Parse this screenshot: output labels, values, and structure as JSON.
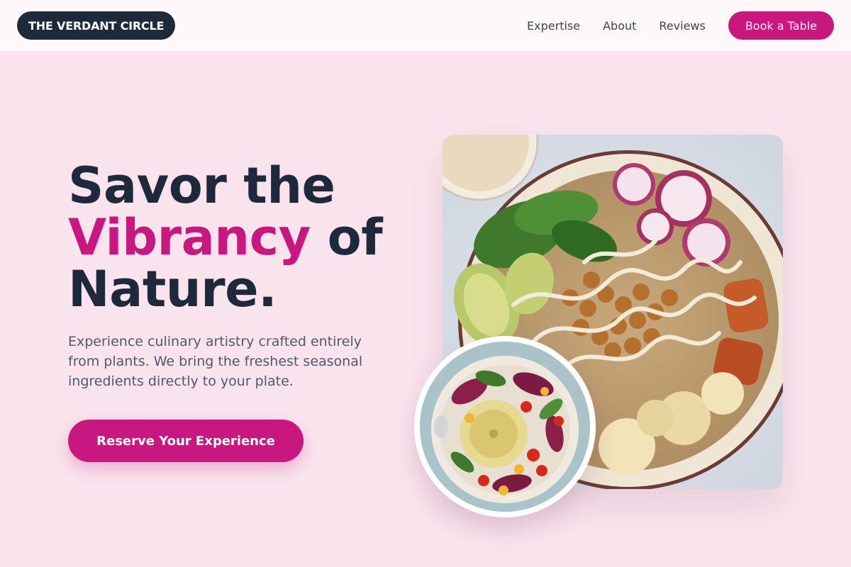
{
  "header": {
    "logo": "THE VERDANT CIRCLE",
    "nav": [
      {
        "label": "Expertise"
      },
      {
        "label": "About"
      },
      {
        "label": "Reviews"
      }
    ],
    "cta_label": "Book a Table"
  },
  "hero": {
    "title_line1": "Savor the",
    "title_accent": "Vibrancy",
    "title_line2_rest": " of",
    "title_line3": "Nature.",
    "subtitle": "Experience culinary artistry crafted entirely from plants. We bring the freshest seasonal ingredients directly to your plate.",
    "cta_label": "Reserve Your Experience"
  },
  "images": {
    "main": "buddha-bowl-photo",
    "inset": "hummus-salad-photo"
  },
  "colors": {
    "background": "#f9e4ed",
    "header_bg": "#fff8fa",
    "accent": "#c8177f",
    "dark": "#1e293b",
    "body_text": "#4d5a6e"
  }
}
